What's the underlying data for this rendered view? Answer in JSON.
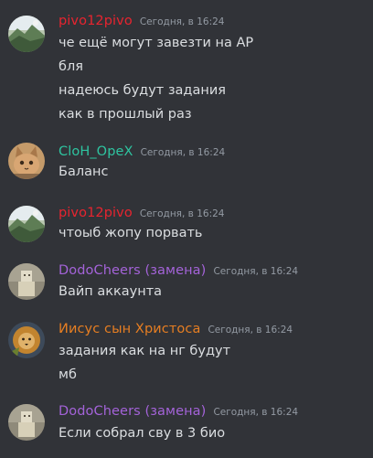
{
  "colors": {
    "background": "#313338",
    "text": "#dbdee1",
    "timestamp": "#949ba4",
    "user_red": "#e8242f",
    "user_green": "#2ec4a0",
    "user_purple": "#a463d9",
    "user_orange": "#e67e22"
  },
  "messages": [
    {
      "username": "pivo12pivo",
      "timestamp": "Сегодня, в 16:24",
      "avatar": "landscape-avatar",
      "lines": [
        "че ещё могут завезти на АР",
        "бля",
        "надеюсь будут задания",
        "как в прошлый раз"
      ]
    },
    {
      "username": "CloH_OpeX",
      "timestamp": "Сегодня, в 16:24",
      "avatar": "cat-avatar",
      "lines": [
        "Баланс"
      ]
    },
    {
      "username": "pivo12pivo",
      "timestamp": "Сегодня, в 16:24",
      "avatar": "landscape-avatar",
      "lines": [
        "чтоыб жопу порвать"
      ]
    },
    {
      "username": "DodoCheers (замена)",
      "timestamp": "Сегодня, в 16:24",
      "avatar": "figure-avatar",
      "lines": [
        "Вайп аккаунта"
      ]
    },
    {
      "username": "Иисус сын Христоса",
      "timestamp": "Сегодня, в 16:24",
      "avatar": "lion-avatar",
      "lines": [
        "задания как на нг будут",
        "мб"
      ]
    },
    {
      "username": "DodoCheers (замена)",
      "timestamp": "Сегодня, в 16:24",
      "avatar": "figure-avatar",
      "lines": [
        "Если собрал сву в 3 био"
      ]
    }
  ]
}
